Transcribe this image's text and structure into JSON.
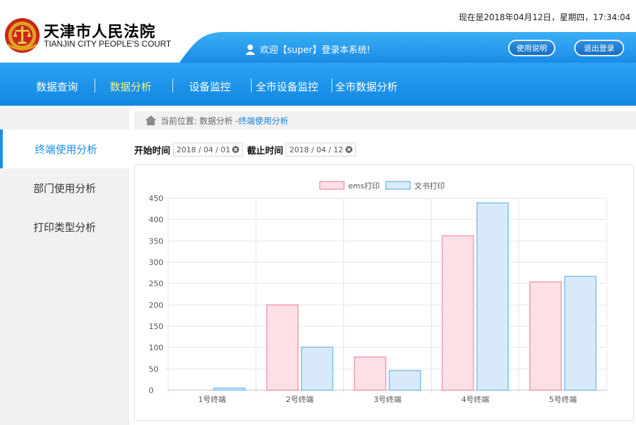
{
  "header": {
    "datetime": "现在是2018年04月12日，星期四，17:34:04",
    "title_cn": "天津市人民法院",
    "title_en": "TIANJIN CITY PEOPLE'S COURT",
    "welcome": "欢迎【super】登录本系统!",
    "help_label": "使用说明",
    "logout_label": "退出登录",
    "emblem_icon": "court-emblem-icon",
    "user_icon": "user-icon",
    "accent_color": "#1a8be5"
  },
  "nav": {
    "items": [
      {
        "label": "数据查询",
        "active": false
      },
      {
        "label": "数据分析",
        "active": true
      },
      {
        "label": "设备监控",
        "active": false
      },
      {
        "label": "全市设备监控",
        "active": false
      },
      {
        "label": "全市数据分析",
        "active": false
      }
    ],
    "active_color": "#f4f17a"
  },
  "sidebar": {
    "items": [
      {
        "label": "终端使用分析",
        "active": true
      },
      {
        "label": "部门使用分析",
        "active": false
      },
      {
        "label": "打印类型分析",
        "active": false
      }
    ]
  },
  "breadcrumb": {
    "prefix": "当前位置: 数据分析 - ",
    "current": "终端使用分析",
    "icon": "home-icon"
  },
  "filters": {
    "start_label": "开始时间",
    "start_value": "2018 / 04 / 01",
    "end_label": "截止时间",
    "end_value": "2018 / 04 / 12",
    "clear_icon": "clear-icon"
  },
  "chart_data": {
    "type": "bar",
    "categories": [
      "1号终端",
      "2号终端",
      "3号终端",
      "4号终端",
      "5号终端"
    ],
    "series": [
      {
        "name": "ems打印",
        "values": [
          0,
          200,
          78,
          362,
          254
        ],
        "fill": "#fde0e6",
        "stroke": "#f087a0"
      },
      {
        "name": "文书打印",
        "values": [
          5,
          101,
          46,
          439,
          267
        ],
        "fill": "#d8eaf9",
        "stroke": "#6bb3e6"
      }
    ],
    "ylim": [
      0,
      450
    ],
    "yticks": [
      0,
      50,
      100,
      150,
      200,
      250,
      300,
      350,
      400,
      450
    ],
    "grid": true,
    "legend": "top-center"
  }
}
